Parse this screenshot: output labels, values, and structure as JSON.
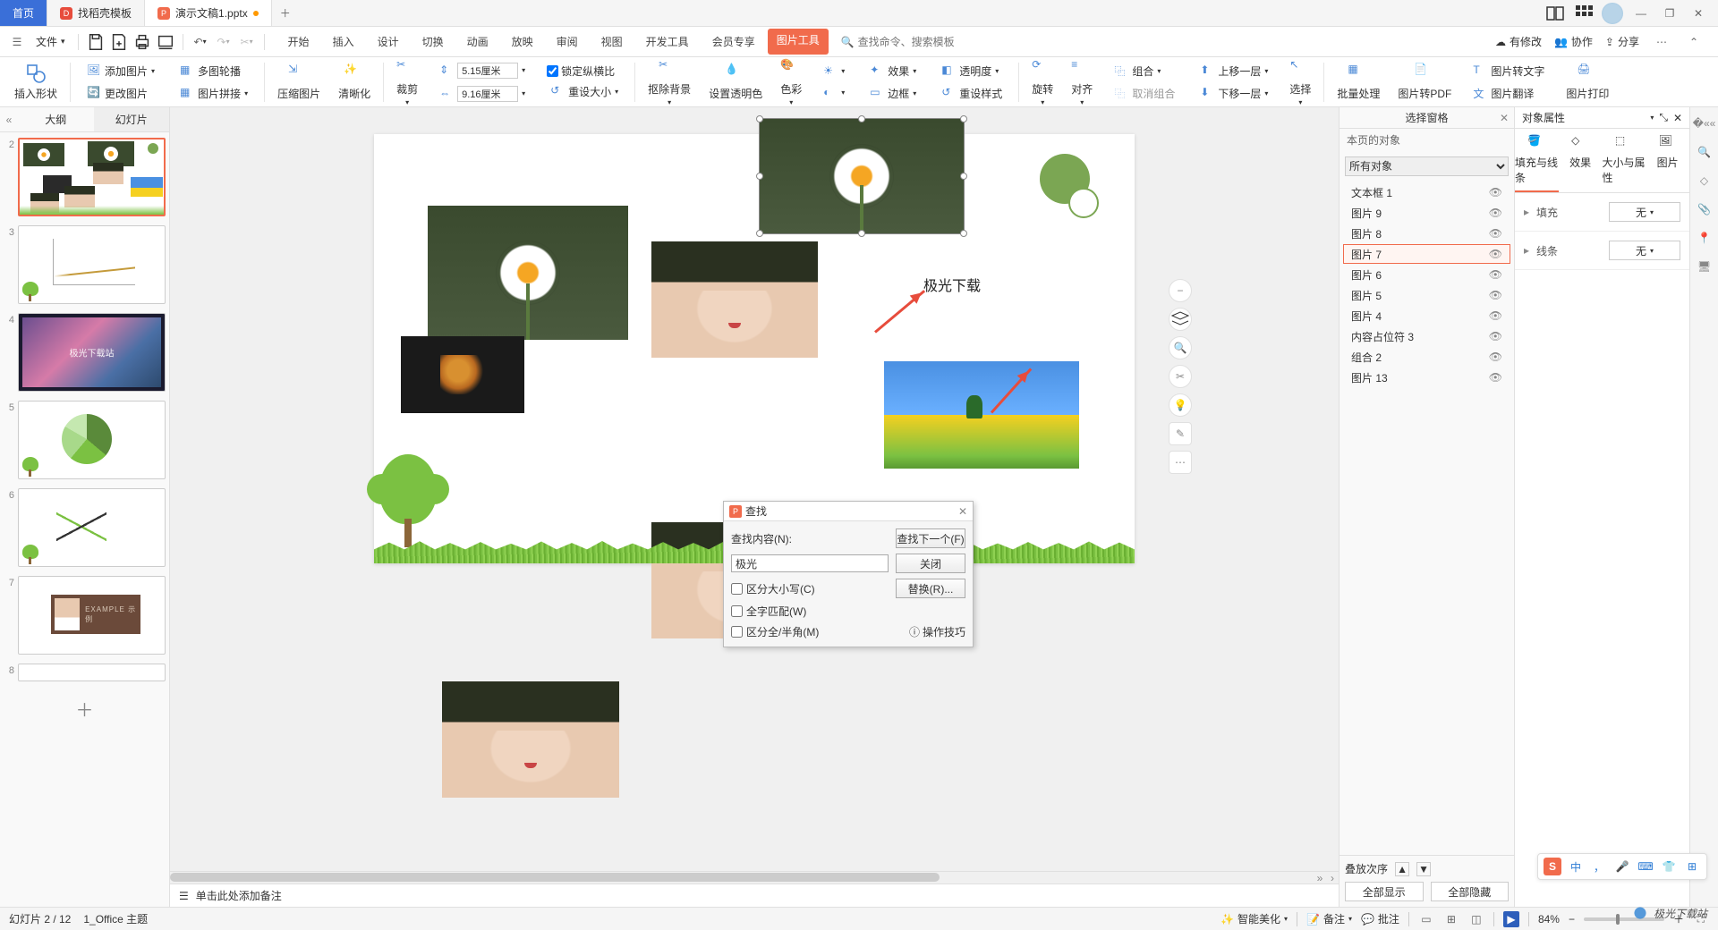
{
  "titlebar": {
    "home": "首页",
    "tab1": "找稻壳模板",
    "tab2": "演示文稿1.pptx"
  },
  "menubar": {
    "file": "文件",
    "tabs": [
      "开始",
      "插入",
      "设计",
      "切换",
      "动画",
      "放映",
      "审阅",
      "视图",
      "开发工具",
      "会员专享"
    ],
    "pic_tool": "图片工具",
    "search_ph": "查找命令、搜索模板",
    "right": {
      "sync": "有修改",
      "coop": "协作",
      "share": "分享"
    }
  },
  "ribbon": {
    "insert_shape": "插入形状",
    "add_pic": "添加图片",
    "multi_outline": "多图轮播",
    "replace_pic": "更改图片",
    "pic_join": "图片拼接",
    "compress": "压缩图片",
    "clarify": "清晰化",
    "crop": "裁剪",
    "h": "5.15厘米",
    "w": "9.16厘米",
    "lock": "锁定纵横比",
    "reset": "重设大小",
    "rm_bg": "抠除背景",
    "set_trans": "设置透明色",
    "color": "色彩",
    "effect": "效果",
    "trans": "透明度",
    "border": "边框",
    "reset_style": "重设样式",
    "rotate": "旋转",
    "align": "对齐",
    "group": "组合",
    "ungroup": "取消组合",
    "up": "上移一层",
    "down": "下移一层",
    "select": "选择",
    "batch": "批量处理",
    "to_pdf": "图片转PDF",
    "to_text": "图片转文字",
    "translate": "图片翻译",
    "print": "图片打印"
  },
  "thumbs": {
    "outline": "大纲",
    "slides": "幻灯片"
  },
  "slide": {
    "text_found": "极光下载"
  },
  "dialog": {
    "title": "查找",
    "label": "查找内容(N):",
    "value": "极光",
    "find_next": "查找下一个(F)",
    "close": "关闭",
    "replace": "替换(R)...",
    "chk_case": "区分大小写(C)",
    "chk_whole": "全字匹配(W)",
    "chk_width": "区分全/半角(M)",
    "tips": "操作技巧"
  },
  "selpane": {
    "title": "选择窗格",
    "page_obj": "本页的对象",
    "all": "所有对象",
    "items": [
      "文本框 1",
      "图片 9",
      "图片 8",
      "图片 7",
      "图片 6",
      "图片 5",
      "图片 4",
      "内容占位符 3",
      "组合 2",
      "图片 13"
    ],
    "selected_index": 3,
    "order": "叠放次序",
    "show_all": "全部显示",
    "hide_all": "全部隐藏"
  },
  "props": {
    "title": "对象属性",
    "tabs": [
      "填充与线条",
      "效果",
      "大小与属性",
      "图片"
    ],
    "fill": "填充",
    "none": "无",
    "line": "线条"
  },
  "notes": "单击此处添加备注",
  "status": {
    "slide": "幻灯片 2 / 12",
    "theme": "1_Office 主题",
    "beautify": "智能美化",
    "remark": "备注",
    "comment": "批注",
    "zoom": "84%"
  },
  "watermark": "极光下载站"
}
